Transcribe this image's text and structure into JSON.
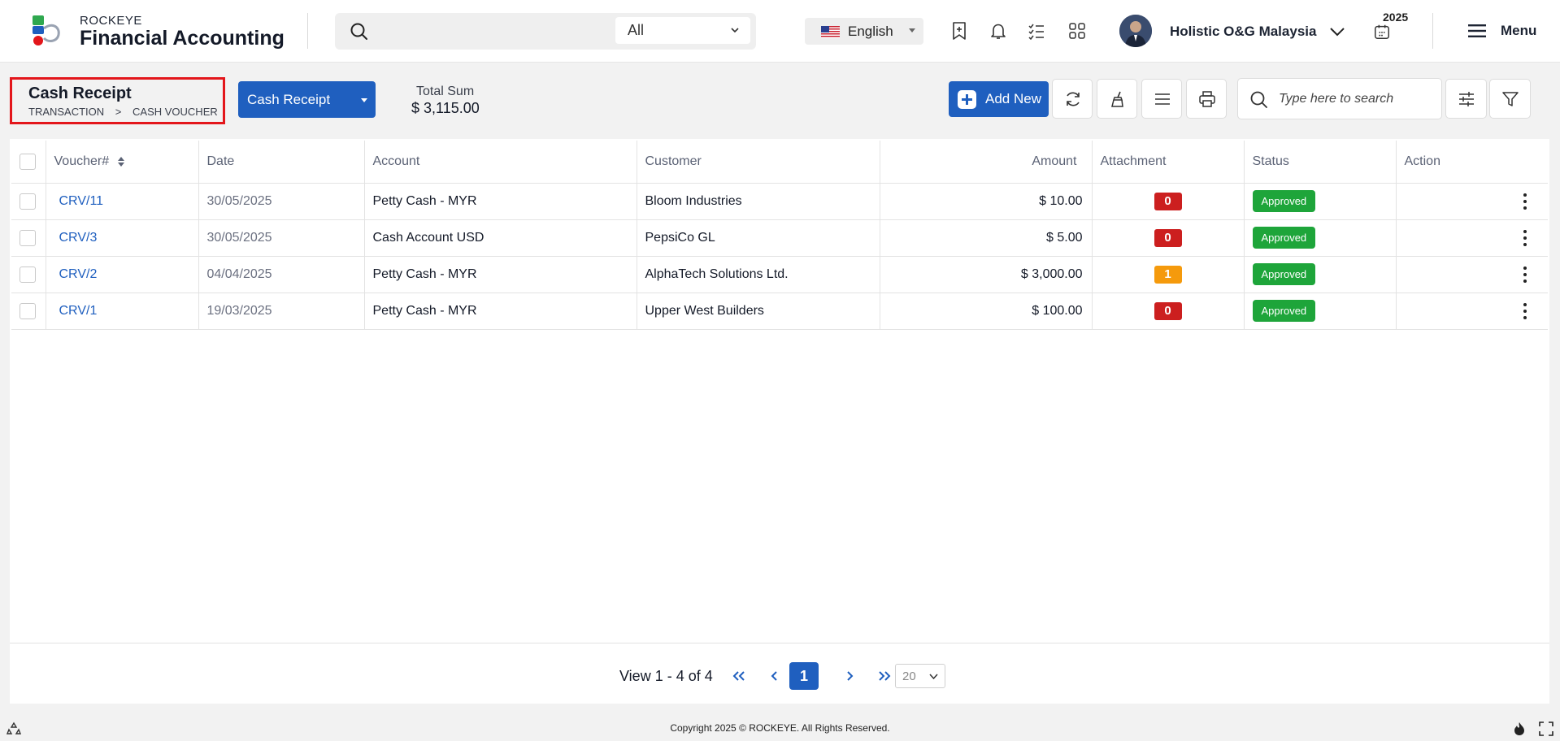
{
  "app": {
    "brand_top": "ROCKEYE",
    "brand_main": "Financial Accounting"
  },
  "topbar": {
    "search_placeholder": "",
    "search_scope": "All",
    "language": "English",
    "company": "Holistic O&G Malaysia",
    "year": "2025",
    "menu_label": "Menu",
    "icons": [
      "search-icon",
      "chevron-down-icon",
      "us-flag-icon",
      "bookmark-add-icon",
      "bell-icon",
      "checklist-icon",
      "apps-grid-icon",
      "avatar",
      "calendar-icon",
      "hamburger-icon"
    ]
  },
  "page": {
    "title": "Cash Receipt",
    "breadcrumb": [
      "TRANSACTION",
      ">",
      "CASH VOUCHER"
    ],
    "type_button": "Cash Receipt",
    "total_label": "Total Sum",
    "total_value": "$ 3,115.00",
    "add_new": "Add New",
    "search_placeholder": "Type here to search",
    "toolbar_icons": [
      "refresh-icon",
      "clear-brush-icon",
      "list-icon",
      "print-icon",
      "search-icon",
      "column-settings-icon",
      "filter-icon"
    ]
  },
  "table": {
    "columns": [
      "",
      "Voucher#",
      "Date",
      "Account",
      "Customer",
      "Amount",
      "Attachment",
      "Status",
      "Action"
    ],
    "rows": [
      {
        "voucher": "CRV/11",
        "date": "30/05/2025",
        "account": "Petty Cash - MYR",
        "customer": "Bloom Industries",
        "amount": "$ 10.00",
        "attachment": "0",
        "status": "Approved"
      },
      {
        "voucher": "CRV/3",
        "date": "30/05/2025",
        "account": "Cash Account USD",
        "customer": "PepsiCo GL",
        "amount": "$ 5.00",
        "attachment": "0",
        "status": "Approved"
      },
      {
        "voucher": "CRV/2",
        "date": "04/04/2025",
        "account": "Petty Cash - MYR",
        "customer": "AlphaTech Solutions Ltd.",
        "amount": "$ 3,000.00",
        "attachment": "1",
        "status": "Approved"
      },
      {
        "voucher": "CRV/1",
        "date": "19/03/2025",
        "account": "Petty Cash - MYR",
        "customer": "Upper West Builders",
        "amount": "$ 100.00",
        "attachment": "0",
        "status": "Approved"
      }
    ]
  },
  "pager": {
    "summary": "View 1 - 4 of 4",
    "current_page": "1",
    "page_size": "20"
  },
  "footer": {
    "copyright": "Copyright 2025 © ROCKEYE. All Rights Reserved."
  },
  "colors": {
    "primary": "#1f5fbf",
    "attachment_zero": "#cc1f1f",
    "attachment_nonzero": "#f59a0c",
    "status_approved": "#1ea53a",
    "highlight_border": "#e3161b"
  }
}
